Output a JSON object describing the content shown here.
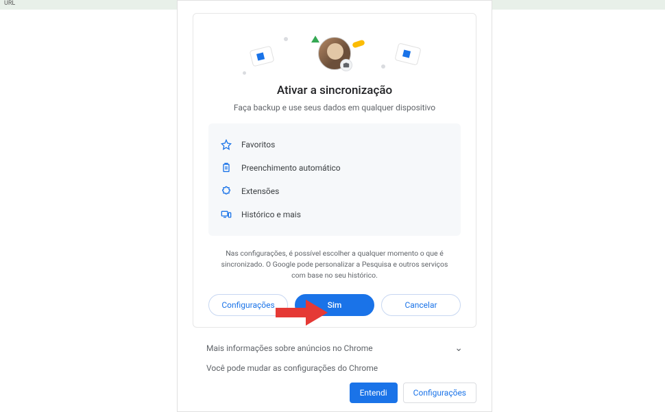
{
  "topbar": {
    "text": "URL"
  },
  "dialog": {
    "title": "Ativar a sincronização",
    "subtitle": "Faça backup e use seus dados em qualquer dispositivo",
    "features": [
      {
        "icon": "star-icon",
        "label": "Favoritos"
      },
      {
        "icon": "clipboard-icon",
        "label": "Preenchimento automático"
      },
      {
        "icon": "puzzle-icon",
        "label": "Extensões"
      },
      {
        "icon": "devices-icon",
        "label": "Histórico e mais"
      }
    ],
    "disclaimer": "Nas configurações, é possível escolher a qualquer momento o que é sincronizado. O Google pode personalizar a Pesquisa e outros serviços com base no seu histórico.",
    "buttons": {
      "settings": "Configurações",
      "yes": "Sim",
      "cancel": "Cancelar"
    }
  },
  "footer": {
    "expand_label": "Mais informações sobre anúncios no Chrome",
    "info_line": "Você pode mudar as configurações do Chrome",
    "ok_button": "Entendi",
    "settings_button": "Configurações"
  },
  "colors": {
    "primary": "#1a73e8",
    "arrow": "#e53935"
  }
}
